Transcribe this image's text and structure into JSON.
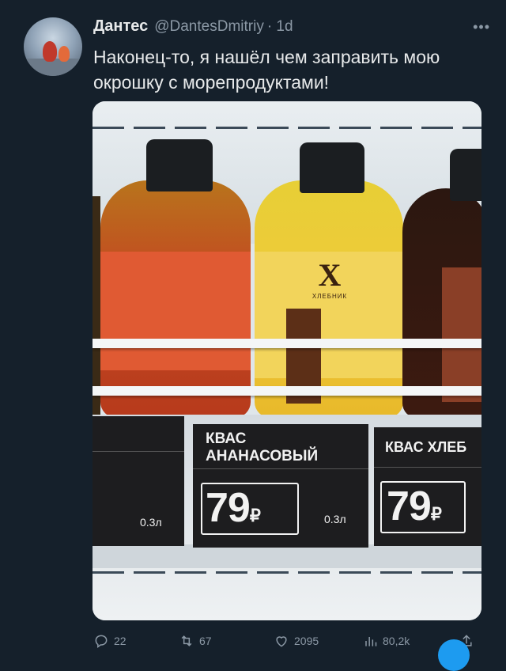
{
  "tweet": {
    "author_name": "Дантес",
    "author_handle": "@DantesDmitriy",
    "time": "· 1d",
    "text": "Наконец-то, я нашёл чем заправить мою окрошку с морепродуктами!"
  },
  "media": {
    "brand_mark": "X",
    "brand_name": "ХЛЕБНИК",
    "tag_mid_name": "КВАС\nАНАНАСОВЫЙ",
    "tag_mid_price": "79",
    "tag_mid_volume": "0.3л",
    "tag_left_volume": "0.3л",
    "tag_right_name": "КВАС ХЛЕБ",
    "tag_right_price": "79",
    "currency": "₽"
  },
  "actions": {
    "replies": "22",
    "retweets": "67",
    "likes": "2095",
    "views": "80,2k"
  },
  "colors": {
    "background": "#15202b",
    "accent": "#1d9bf0",
    "secondary_text": "#8b98a5"
  }
}
